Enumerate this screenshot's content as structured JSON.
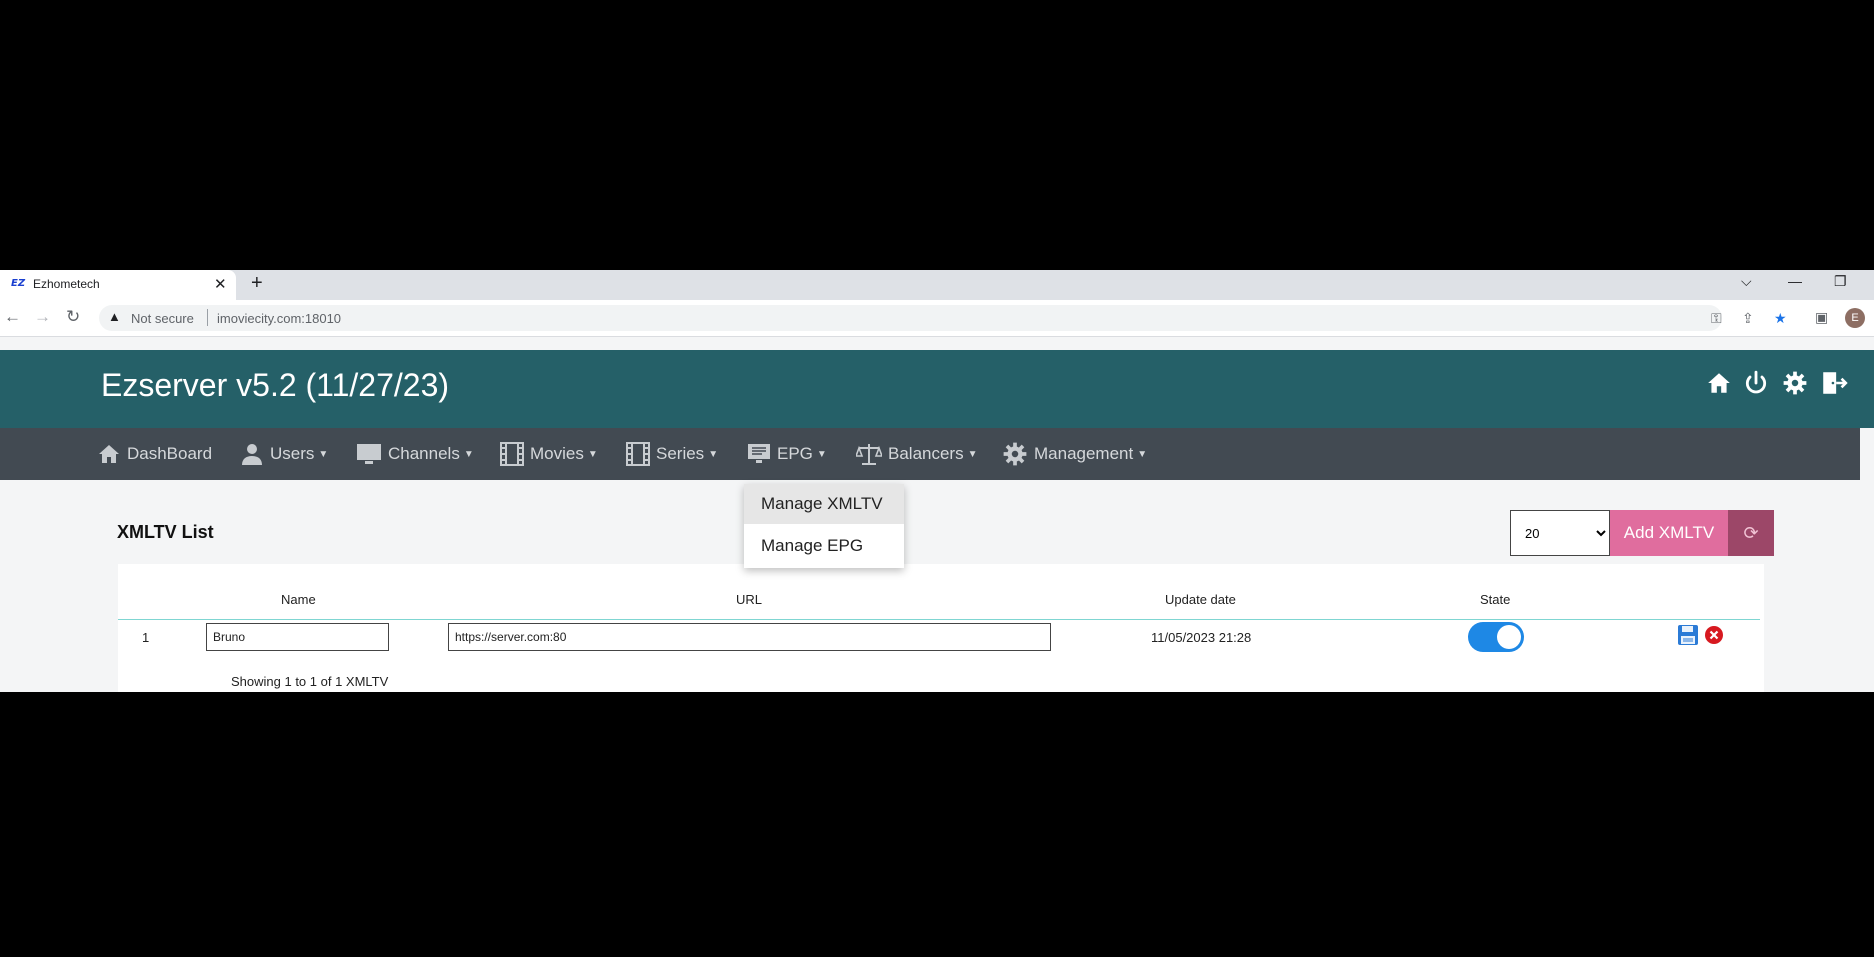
{
  "browser": {
    "tab_favicon": "EZ",
    "tab_title": "Ezhometech",
    "tab_close": "✕",
    "new_tab": "+",
    "security_label": "Not secure",
    "url": "imoviecity.com:18010",
    "profile_initial": "E"
  },
  "app": {
    "brand": "Ezserver v5.2 (11/27/23)"
  },
  "nav": {
    "items": [
      {
        "label": "DashBoard",
        "icon": "home-icon",
        "caret": false
      },
      {
        "label": "Users",
        "icon": "user-icon",
        "caret": true
      },
      {
        "label": "Channels",
        "icon": "monitor-icon",
        "caret": true
      },
      {
        "label": "Movies",
        "icon": "film-icon",
        "caret": true
      },
      {
        "label": "Series",
        "icon": "film-icon",
        "caret": true
      },
      {
        "label": "EPG",
        "icon": "epg-icon",
        "caret": true
      },
      {
        "label": "Balancers",
        "icon": "scale-icon",
        "caret": true
      },
      {
        "label": "Management",
        "icon": "gear-icon",
        "caret": true
      }
    ]
  },
  "epg_menu": {
    "items": [
      "Manage XMLTV",
      "Manage EPG"
    ]
  },
  "page": {
    "title": "XMLTV List",
    "page_size": "20",
    "add_label": "Add XMLTV",
    "refresh_icon": "refresh-icon"
  },
  "table": {
    "headers": [
      "Name",
      "URL",
      "Update date",
      "State"
    ],
    "rows": [
      {
        "index": "1",
        "name": "Bruno",
        "url": "https://server.com:80",
        "update_date": "11/05/2023 21:28",
        "state": true
      }
    ],
    "footer": "Showing 1 to 1 of 1 XMLTV"
  },
  "colors": {
    "header_bg": "#256068",
    "navbar_bg": "#424a52",
    "add_button": "#e06d9e",
    "refresh_button": "#9c4768",
    "toggle_on": "#1e88e5"
  }
}
